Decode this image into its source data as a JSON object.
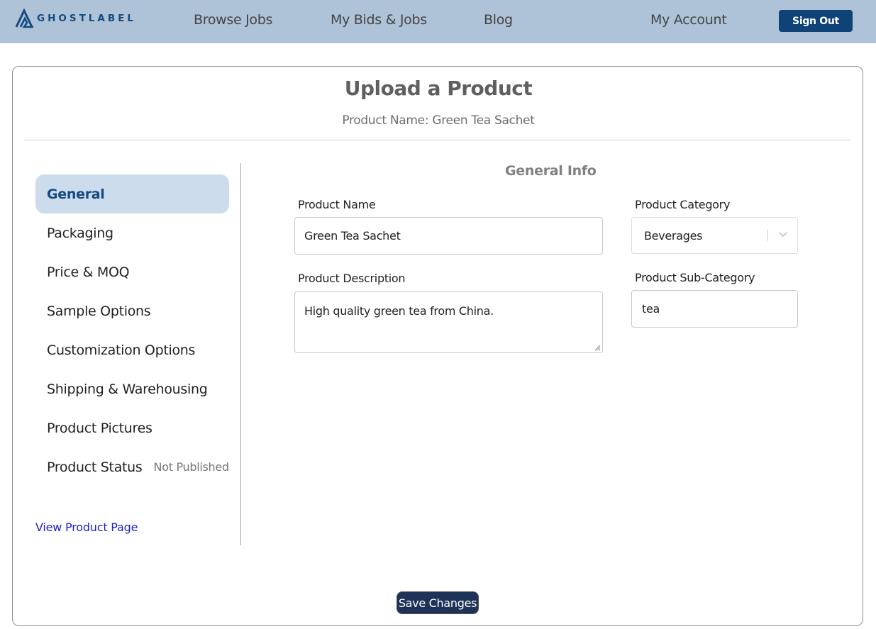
{
  "header": {
    "brand": "GHOSTLABEL",
    "nav": {
      "browse_jobs": "Browse Jobs",
      "my_bids_jobs": "My Bids & Jobs",
      "blog": "Blog",
      "my_account": "My Account"
    },
    "sign_out_label": "Sign Out"
  },
  "page": {
    "title": "Upload a Product",
    "product_name_line": "Product Name: Green Tea Sachet"
  },
  "sidebar": {
    "items": [
      {
        "label": "General",
        "active": true
      },
      {
        "label": "Packaging"
      },
      {
        "label": "Price & MOQ"
      },
      {
        "label": "Sample Options"
      },
      {
        "label": "Customization Options"
      },
      {
        "label": "Shipping & Warehousing"
      },
      {
        "label": "Product Pictures"
      },
      {
        "label": "Product Status",
        "status": "Not Published"
      }
    ],
    "view_product_page": "View Product Page"
  },
  "form": {
    "section_title": "General Info",
    "product_name": {
      "label": "Product Name",
      "value": "Green Tea Sachet"
    },
    "product_description": {
      "label": "Product Description",
      "value": "High quality green tea from China."
    },
    "product_category": {
      "label": "Product Category",
      "value": "Beverages"
    },
    "product_sub_category": {
      "label": "Product Sub-Category",
      "value": "tea"
    }
  },
  "save_label": "Save Changes",
  "colors": {
    "header_bg": "#aec3d8",
    "brand_blue": "#154a80",
    "sign_out_bg": "#0f4377",
    "active_item_bg": "#ccdcec",
    "save_bg": "#1e3357",
    "link": "#2020d0"
  }
}
